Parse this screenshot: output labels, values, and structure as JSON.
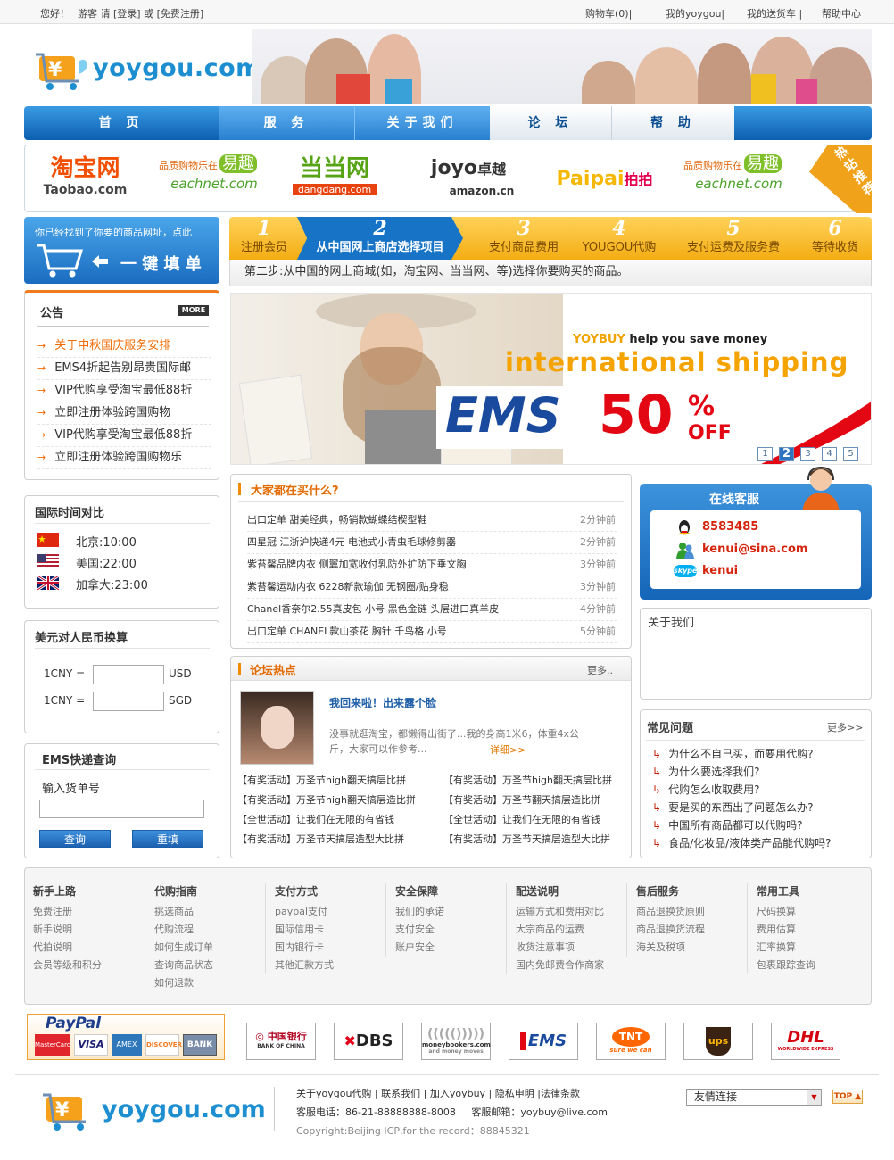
{
  "topbar": {
    "greeting": "您好！",
    "guest": "游客 请 [登录] 或 [免费注册]",
    "cart": "购物车(0)|",
    "my_yoygou": "我的yoygou|",
    "my_delivery": "我的送货车 |",
    "help_center": "帮助中心"
  },
  "header": {
    "logo_text": "yoygou.com"
  },
  "nav": [
    {
      "label": "首 页"
    },
    {
      "label": "服 务"
    },
    {
      "label": "关于我们"
    },
    {
      "label": "论 坛"
    },
    {
      "label": "帮 助"
    }
  ],
  "partners": {
    "taobao_cn": "淘宝网",
    "taobao_en": "Taobao.com",
    "eachnet_tag": "品质购物乐在",
    "eachnet_yq": "易趣",
    "eachnet_en": "eachnet.com",
    "dangdang_cn": "当当网",
    "dangdang_en": "dangdang.com",
    "joyo_en": "joyo",
    "joyo_cn": "卓越",
    "joyo_sub": "amazon.cn",
    "paipai_en": "Paipai",
    "paipai_cn": "拍拍",
    "hot": "热站推荐"
  },
  "oneclick": {
    "line1": "你已经找到了你要的商品网址，点此",
    "line2": "一 键 填 单"
  },
  "steps": [
    {
      "n": "1",
      "label": "注册会员"
    },
    {
      "n": "2",
      "label": "从中国网上商店选择项目"
    },
    {
      "n": "3",
      "label": "支付商品费用"
    },
    {
      "n": "4",
      "label": "YOUGOU代购"
    },
    {
      "n": "5",
      "label": "支付运费及服务费"
    },
    {
      "n": "6",
      "label": "等待收货"
    }
  ],
  "step_desc": "第二步:从中国的网上商城(如，淘宝网、当当网、等)选择你要购买的商品。",
  "notice": {
    "title": "公告",
    "more": "MORE",
    "items": [
      "关于中秋国庆服务安排",
      "EMS4折起告别昂贵国际邮",
      "VIP代购享受淘宝最低88折",
      "立即注册体验跨国购物",
      "VIP代购享受淘宝最低88折",
      "立即注册体验跨国购物乐"
    ]
  },
  "time": {
    "title": "国际时间对比",
    "rows": [
      {
        "label": "北京:10:00"
      },
      {
        "label": "美国:22:00"
      },
      {
        "label": "加拿大:23:00"
      }
    ]
  },
  "currency": {
    "title": "美元对人民币换算",
    "row1_left": "1CNY =",
    "row1_right": "USD",
    "row2_left": "1CNY =",
    "row2_right": "SGD"
  },
  "ems": {
    "title": "EMS快递查询",
    "label": "输入货单号",
    "query": "查询",
    "reset": "重填"
  },
  "promo": {
    "brand": "YOYBUY",
    "tagline": " help you save  money",
    "headline": "international shipping",
    "ems": "EMS",
    "discount": "50",
    "percent": "%",
    "off": "OFF",
    "pages": [
      "1",
      "2",
      "3",
      "4",
      "5"
    ],
    "active_page": 2
  },
  "buying": {
    "title": "大家都在买什么?",
    "items": [
      {
        "text": "出口定单 甜美经典，畅销款蝴蝶结楔型鞋",
        "time": "2分钟前"
      },
      {
        "text": "四星冠 江浙沪快递4元 电池式小青虫毛球修剪器",
        "time": "2分钟前"
      },
      {
        "text": "紫苔馨品牌内衣 侧翼加宽收付乳防外扩防下垂文胸",
        "time": "3分钟前"
      },
      {
        "text": "紫苔馨运动内衣 6228新款瑜伽 无钢圈/贴身稳",
        "time": "3分钟前"
      },
      {
        "text": "Chanel香奈尔2.55真皮包 小号 黑色金链 头层进口真羊皮",
        "time": "4分钟前"
      },
      {
        "text": "出口定单 CHANEL款山茶花 胸针 千鸟格 小号",
        "time": "5分钟前"
      }
    ]
  },
  "forum": {
    "title": "论坛热点",
    "more": "更多..",
    "post_title": "我回来啦！出来露个脸",
    "post_body": "没事就逛淘宝，都懒得出街了...我的身高1米6，体重4x公斤，大家可以作参考...",
    "detail": "详细>>",
    "links": [
      "【有奖活动】万圣节high翻天搞层比拼",
      "【有奖活动】万圣节high翻天搞层比拼",
      "【有奖活动】万圣节high翻天搞层造比拼",
      "【有奖活动】万圣节翻天搞层造比拼",
      "【全世活动】让我们在无限的有省钱",
      "【全世活动】让我们在无限的有省钱",
      "【有奖活动】万圣节天搞层造型大比拼",
      "【有奖活动】万圣节天搞层造型大比拼"
    ]
  },
  "service": {
    "title": "在线客服",
    "qq": "8583485",
    "msn": "kenui@sina.com",
    "skype": "kenui",
    "skype_logo": "skype"
  },
  "about": {
    "title": "关于我们"
  },
  "faq": {
    "title": "常见问题",
    "more": "更多>>",
    "items": [
      "为什么不自己买，而要用代购?",
      "为什么要选择我们?",
      "代购怎么收取费用?",
      "要是买的东西出了问题怎么办?",
      "中国所有商品都可以代购吗?",
      "食品/化妆品/液体类产品能代购吗?"
    ]
  },
  "footer_links": [
    {
      "title": "新手上路",
      "items": [
        "免费注册",
        "新手说明",
        "代拍说明",
        "会员等级和积分"
      ]
    },
    {
      "title": "代购指南",
      "items": [
        "挑选商品",
        "代购流程",
        "如何生成订单",
        "查询商品状态",
        "如何退款"
      ]
    },
    {
      "title": "支付方式",
      "items": [
        "paypal支付",
        "国际信用卡",
        "国内银行卡",
        "其他汇款方式"
      ]
    },
    {
      "title": "安全保障",
      "items": [
        "我们的承诺",
        "支付安全",
        "账户安全"
      ]
    },
    {
      "title": "配送说明",
      "items": [
        "运输方式和费用对比",
        "大宗商品的运费",
        "收货注意事项",
        "国内免邮费合作商家"
      ]
    },
    {
      "title": "售后服务",
      "items": [
        "商品退换货原则",
        "商品退换货流程",
        "海关及税项"
      ]
    },
    {
      "title": "常用工具",
      "items": [
        "尺码换算",
        "费用估算",
        "汇率换算",
        "包裹跟踪查询"
      ]
    }
  ],
  "payments": {
    "paypal": "PayPal",
    "cards": [
      "MasterCard",
      "VISA",
      "AMEX",
      "DISCOVER",
      "BANK"
    ],
    "boc_cn": "中国银行",
    "boc_en": "BANK OF CHINA",
    "dbs": "DBS",
    "moneybookers": "moneybookers.com",
    "moneybookers_sub": "and money moves",
    "ems": "EMS",
    "tnt": "TNT",
    "tnt_sub": "sure we can",
    "ups": "ups",
    "dhl": "DHL",
    "dhl_sub": "WORLDWIDE EXPRESS"
  },
  "bottom": {
    "logo_text": "yoygou.com",
    "links": "关于yoygou代购 | 联系我们 | 加入yoybuy | 隐私申明  |法律条款",
    "phone": "客服电话：86-21-88888888-8008     客服邮箱：yoybuy@live.com",
    "copyright": "Copyright:Beijing ICP,for the record：88845321",
    "friend_select": "友情连接",
    "top": "TOP"
  },
  "colors": {
    "accent_blue": "#1773c6",
    "accent_orange": "#f26a00",
    "step_yellow": "#f4ad13"
  }
}
